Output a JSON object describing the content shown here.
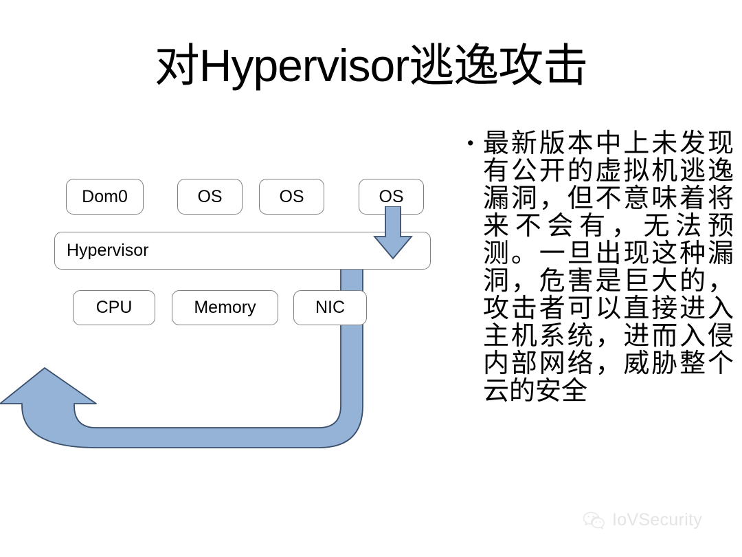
{
  "slide": {
    "title": "对Hypervisor逃逸攻击",
    "background_color": "#ffffff"
  },
  "diagram": {
    "name": "hypervisor-escape-attack-diagram",
    "accent_color": "#95b3d7",
    "accent_border_color": "#3a4f6b",
    "box_border_color": "#7f7f7f",
    "guest_row": [
      {
        "id": "dom0",
        "label": "Dom0"
      },
      {
        "id": "os-1",
        "label": "OS"
      },
      {
        "id": "os-2",
        "label": "OS"
      },
      {
        "id": "os-3",
        "label": "OS"
      }
    ],
    "hypervisor": {
      "id": "hypervisor",
      "label": "Hypervisor"
    },
    "hardware_row": [
      {
        "id": "cpu",
        "label": "CPU"
      },
      {
        "id": "memory",
        "label": "Memory"
      },
      {
        "id": "nic",
        "label": "NIC"
      }
    ],
    "arrows": [
      {
        "id": "escape-down-arrow",
        "direction": "down",
        "from": "os-3",
        "to": "hypervisor"
      },
      {
        "id": "escape-loop-arrow",
        "direction": "up-left",
        "from": "hypervisor",
        "to": "external-network"
      }
    ]
  },
  "body": {
    "bullet_marker": "•",
    "text": "最新版本中上未发现有公开的虚拟机逃逸漏洞，但不意味着将来不会有，无法预测。一旦出现这种漏洞，危害是巨大的，攻击者可以直接进入主机系统，进而入侵内部网络，威胁整个云的安全"
  },
  "watermark": {
    "icon": "wechat-icon",
    "label": "IoVSecurity",
    "color": "#e2e2e2"
  }
}
